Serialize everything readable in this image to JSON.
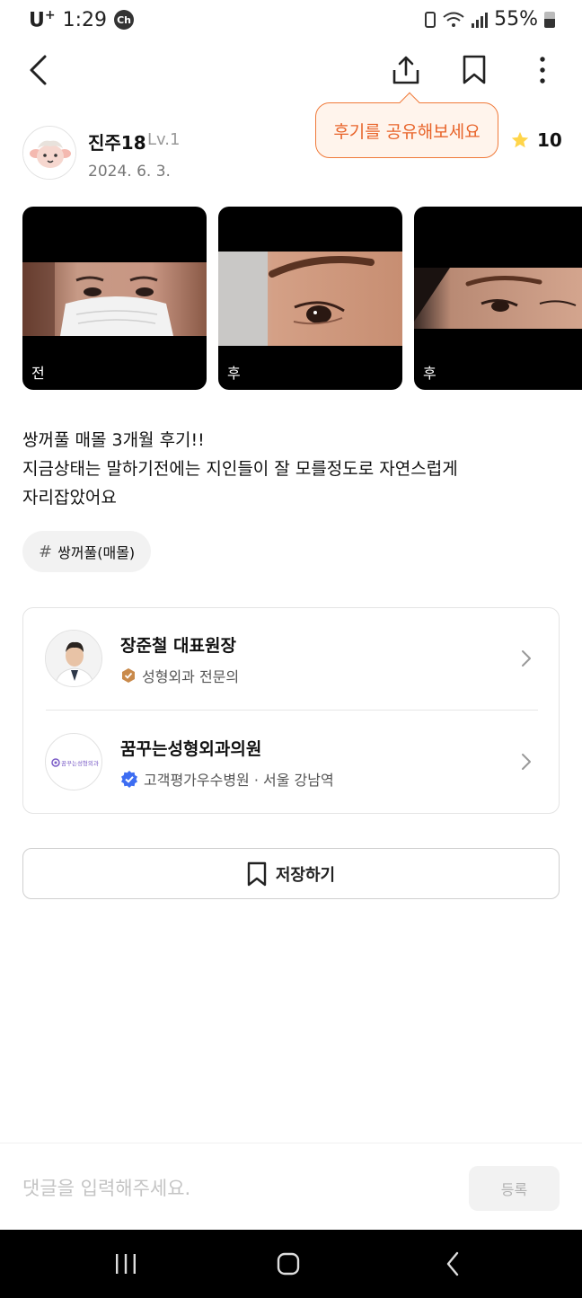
{
  "status_bar": {
    "carrier": "U",
    "carrier_sup": "+",
    "time": "1:29",
    "chat_badge": "Ch",
    "battery": "55%"
  },
  "tooltip": {
    "text": "후기를 공유해보세요"
  },
  "author": {
    "name": "진주18",
    "level": "Lv.1",
    "date": "2024. 6. 3."
  },
  "rating": {
    "value": "10",
    "star_color": "#ffd54a"
  },
  "photos": [
    {
      "label": "전"
    },
    {
      "label": "후"
    },
    {
      "label": "후"
    }
  ],
  "body": {
    "lines": [
      "쌍꺼풀 매몰 3개월 후기!!",
      "지금상태는 말하기전에는 지인들이 잘 모를정도로 자연스럽게",
      "자리잡았어요"
    ]
  },
  "hashtag": {
    "hash": "#",
    "label": "쌍꺼풀(매몰)"
  },
  "doctor": {
    "name": "장준철 대표원장",
    "specialty": "성형외과 전문의",
    "badge_color": "#c98a4b"
  },
  "clinic": {
    "name": "꿈꾸는성형외과의원",
    "logo_text": "꿈꾸는성형외과",
    "info": "고객평가우수병원 · 서울 강남역",
    "badge_color": "#3d6df2"
  },
  "save_button": {
    "label": "저장하기"
  },
  "comment": {
    "placeholder": "댓글을 입력해주세요.",
    "submit_label": "등록"
  },
  "colors": {
    "accent": "#f07a3a",
    "tooltip_bg": "#fff4ec"
  }
}
